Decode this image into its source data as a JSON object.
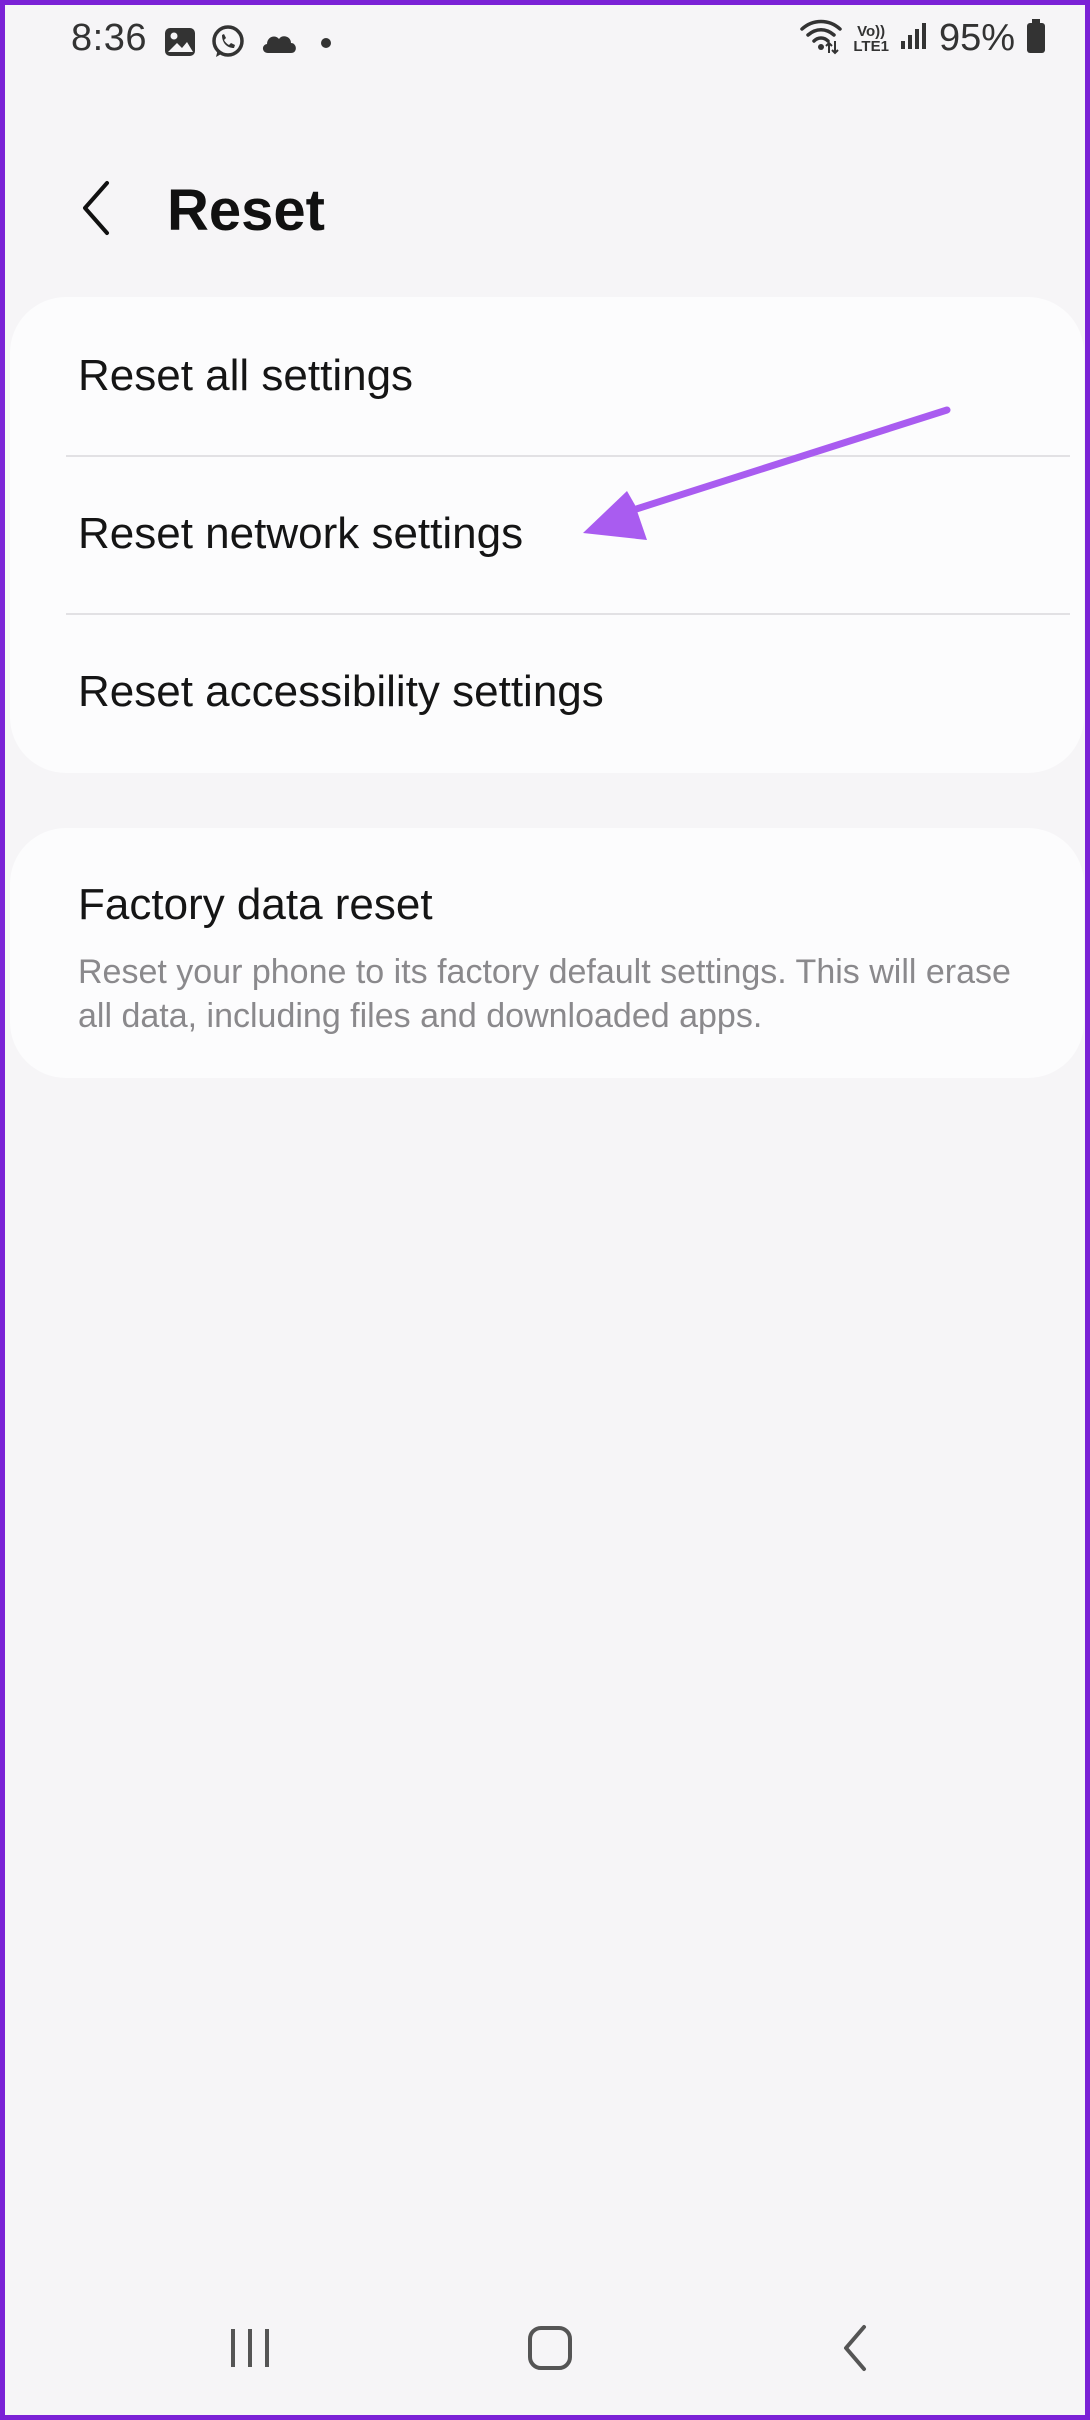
{
  "status_bar": {
    "time": "8:36",
    "left_icons": [
      "gallery-icon",
      "whatsapp-icon",
      "cloud-icon",
      "dot-icon"
    ],
    "volte_top": "Vo))",
    "volte_bottom": "LTE1",
    "battery_percent": "95%",
    "right_icons": [
      "wifi-icon",
      "volte-icon",
      "signal-icon",
      "battery-icon"
    ]
  },
  "header": {
    "title": "Reset",
    "back_icon": "chevron-left-icon"
  },
  "reset_options": [
    {
      "label": "Reset all settings"
    },
    {
      "label": "Reset network settings"
    },
    {
      "label": "Reset accessibility settings"
    }
  ],
  "factory_reset": {
    "title": "Factory data reset",
    "description": "Reset your phone to its factory default settings. This will erase all data, including files and downloaded apps."
  },
  "annotation": {
    "arrow_color": "#a95cf0",
    "target": "Reset network settings"
  },
  "nav_bar": {
    "buttons": [
      "recents-icon",
      "home-icon",
      "back-icon"
    ]
  },
  "colors": {
    "frame_border": "#7b22d6",
    "background": "#f6f5f7",
    "card": "#fcfcfd"
  }
}
